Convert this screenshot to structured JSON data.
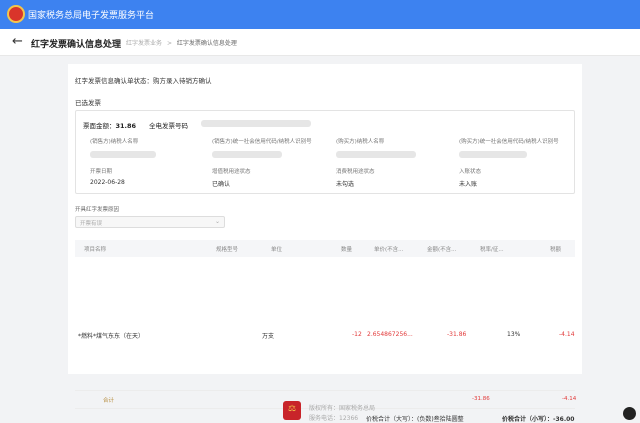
{
  "app": {
    "title": "国家税务总局电子发票服务平台"
  },
  "header": {
    "title": "红字发票确认信息处理",
    "breadcrumb": [
      "红字发票业务",
      "红字发票确认信息处理"
    ],
    "breadcrumb_sep": ">"
  },
  "confirm": {
    "status_line": "红字发票信息确认单状态：购方录入待销方确认",
    "selected_title": "已选发票",
    "amount_label": "票面金额：",
    "amount_value": "31.86",
    "einvoice_label": "全电发票号码",
    "fields": [
      {
        "label": "(销售方)纳税人名称"
      },
      {
        "label": "(销售方)统一社会信用代码/纳税人识别号"
      },
      {
        "label": "(购买方)纳税人名称"
      },
      {
        "label": "(购买方)统一社会信用代码/纳税人识别号"
      },
      {
        "label": "开票日期",
        "value": "2022-06-28"
      },
      {
        "label": "增值税用途状态",
        "value": "已确认"
      },
      {
        "label": "消费税用途状态",
        "value": "未勾选"
      },
      {
        "label": "入账状态",
        "value": "未入账"
      }
    ]
  },
  "reason": {
    "label": "开具红字发票原因",
    "placeholder": "开票有误"
  },
  "table": {
    "headers": [
      "项目名称",
      "规格型号",
      "单位",
      "数量",
      "单价(不含...",
      "金额(不含...",
      "税率/征...",
      "税额"
    ],
    "rows": [
      {
        "name": "*燃料*煤气东东（在天）",
        "spec": "",
        "unit": "万支",
        "qty": "-12",
        "price": "2.654867256...",
        "amount": "-31.86",
        "rate": "13%",
        "tax": "-4.14"
      }
    ],
    "total_label": "合计",
    "total_amount": "-31.86",
    "total_tax": "-4.14",
    "grand_label": "价税合计（大写）：(负数)叁拾陆圆整",
    "grand_small": "价税合计（小写）：-36.00"
  },
  "footer": {
    "owner": "版权所有：国家税务总局",
    "phone": "服务电话：12366"
  },
  "colors": {
    "topbar": "#3d82f0",
    "negative": "#e23a3a"
  }
}
